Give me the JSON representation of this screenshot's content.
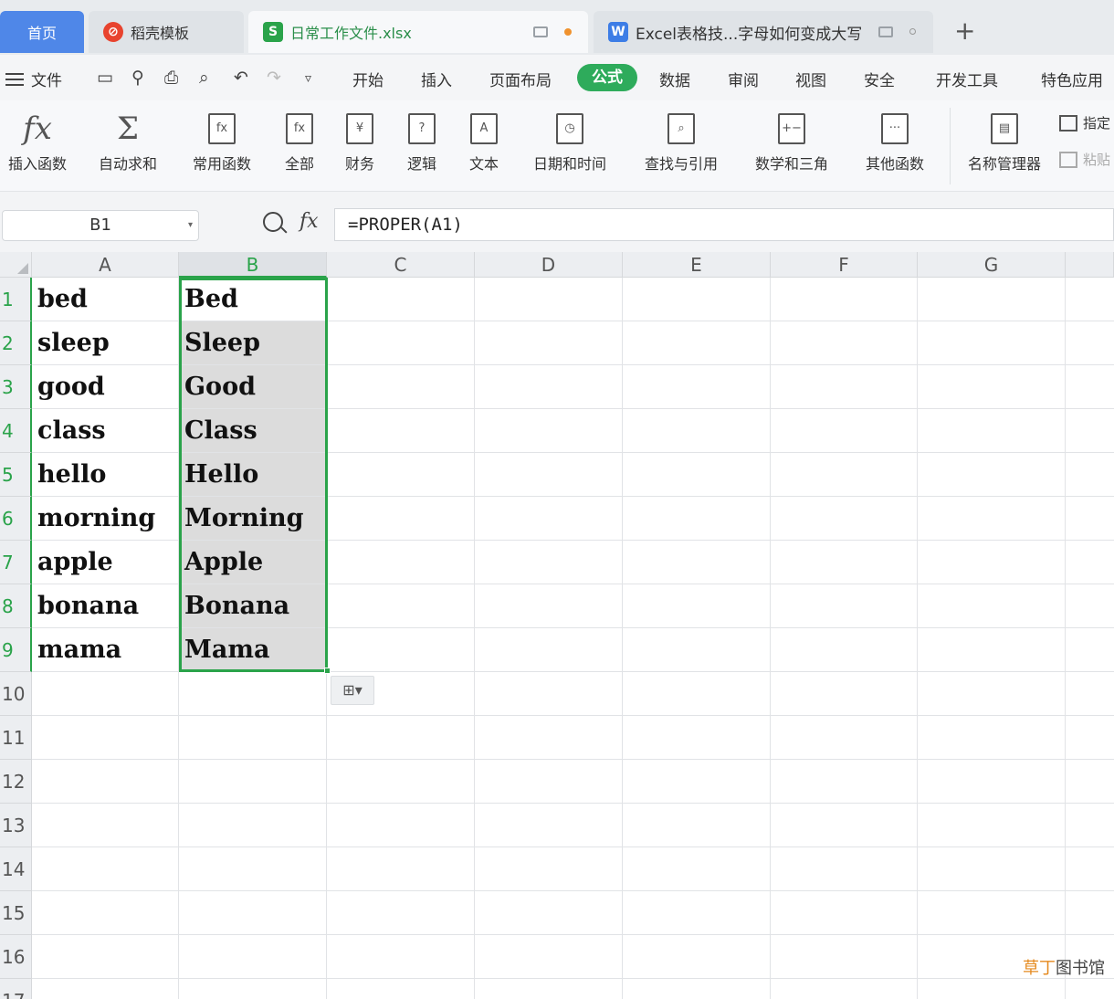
{
  "tabs": {
    "home": "首页",
    "daoke": "稻壳模板",
    "daily": "日常工作文件.xlsx",
    "excel": "Excel表格技...字母如何变成大写",
    "plus": "+"
  },
  "menu": {
    "file": "文件",
    "items": [
      "开始",
      "插入",
      "页面布局",
      "公式",
      "数据",
      "审阅",
      "视图",
      "安全",
      "开发工具",
      "特色应用"
    ]
  },
  "ribbon": {
    "buttons": [
      "插入函数",
      "自动求和",
      "常用函数",
      "全部",
      "财务",
      "逻辑",
      "文本",
      "日期和时间",
      "查找与引用",
      "数学和三角",
      "其他函数",
      "名称管理器"
    ],
    "side_top": "指定",
    "side_bottom": "粘贴"
  },
  "formula_bar": {
    "name_box": "B1",
    "formula": "=PROPER(A1)"
  },
  "grid": {
    "columns": [
      "A",
      "B",
      "C",
      "D",
      "E",
      "F",
      "G"
    ],
    "rows": [
      "1",
      "2",
      "3",
      "4",
      "5",
      "6",
      "7",
      "8",
      "9",
      "10",
      "11",
      "12",
      "13",
      "14",
      "15",
      "16",
      "17"
    ],
    "col_a": [
      "bed",
      "sleep",
      "good",
      "class",
      "hello",
      "morning",
      "apple",
      "bonana",
      "mama"
    ],
    "col_b": [
      "Bed",
      "Sleep",
      "Good",
      "Class",
      "Hello",
      "Morning",
      "Apple",
      "Bonana",
      "Mama"
    ]
  },
  "watermark": {
    "part1": "草丁",
    "part2": "图书馆"
  },
  "colors": {
    "accent_green": "#2aa34a",
    "tab_home_blue": "#4f87e8",
    "selected_fill": "#dcdcdc"
  }
}
